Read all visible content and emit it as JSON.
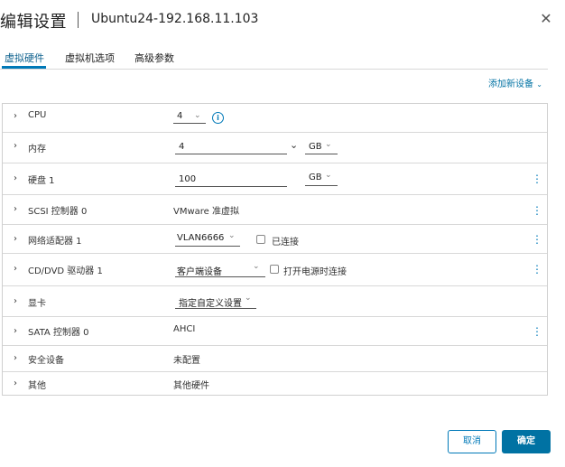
{
  "header": {
    "title": "编辑设置",
    "vm_name": "Ubuntu24-192.168.11.103"
  },
  "tabs": [
    {
      "label": "虚拟硬件"
    },
    {
      "label": "虚拟机选项"
    },
    {
      "label": "高级参数"
    }
  ],
  "add_device": "添加新设备",
  "rows": {
    "cpu": {
      "label": "CPU",
      "value": "4"
    },
    "memory": {
      "label": "内存",
      "value": "4",
      "unit": "GB"
    },
    "disk": {
      "label": "硬盘 1",
      "value": "100",
      "unit": "GB"
    },
    "scsi": {
      "label": "SCSI 控制器 0",
      "value": "VMware 准虚拟"
    },
    "network": {
      "label": "网络适配器 1",
      "value": "VLAN6666",
      "checkbox": "已连接"
    },
    "cdrom": {
      "label": "CD/DVD 驱动器 1",
      "value": "客户端设备",
      "checkbox": "打开电源时连接"
    },
    "video": {
      "label": "显卡",
      "value": "指定自定义设置"
    },
    "sata": {
      "label": "SATA 控制器 0",
      "value": "AHCI"
    },
    "security": {
      "label": "安全设备",
      "value": "未配置"
    },
    "other": {
      "label": "其他",
      "value": "其他硬件"
    }
  },
  "buttons": {
    "cancel": "取消",
    "ok": "确定"
  }
}
